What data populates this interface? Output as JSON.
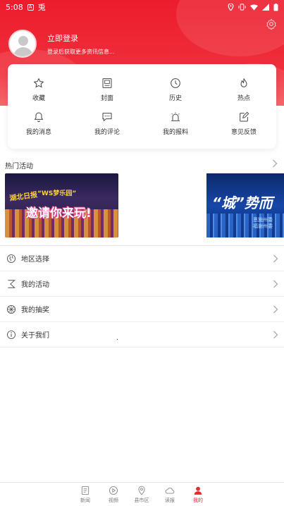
{
  "status_bar": {
    "time": "5:08",
    "box_glyph": "A",
    "extra_glyph": "兎"
  },
  "profile": {
    "login_title": "立即登录",
    "login_subtitle": "登录后获取更多资讯信息..."
  },
  "quick_actions": [
    {
      "label": "收藏",
      "icon": "star-icon"
    },
    {
      "label": "封面",
      "icon": "cover-icon"
    },
    {
      "label": "历史",
      "icon": "clock-icon"
    },
    {
      "label": "热点",
      "icon": "flame-icon"
    },
    {
      "label": "我的消息",
      "icon": "bell-icon"
    },
    {
      "label": "我的评论",
      "icon": "comment-icon"
    },
    {
      "label": "我的报料",
      "icon": "siren-icon"
    },
    {
      "label": "意见反馈",
      "icon": "edit-icon"
    }
  ],
  "hot_events": {
    "title": "热门活动",
    "banner1": {
      "line1": "湖北日报",
      "line2": "“WS梦乐园”",
      "line3": "邀请你来玩!"
    },
    "banner2": {
      "line1": "“城”势而",
      "line2": "恩施州委",
      "line3": "福谢州委"
    }
  },
  "menu": [
    {
      "label": "地区选择",
      "icon": "region-icon"
    },
    {
      "label": "我的活动",
      "icon": "activity-icon"
    },
    {
      "label": "我的抽奖",
      "icon": "lottery-icon"
    },
    {
      "label": "关于我们",
      "icon": "info-icon"
    }
  ],
  "bottom_nav": [
    {
      "label": "新闻",
      "icon": "news-icon",
      "active": false
    },
    {
      "label": "视频",
      "icon": "video-icon",
      "active": false
    },
    {
      "label": "县市区",
      "icon": "location-icon",
      "active": false
    },
    {
      "label": "读报",
      "icon": "cloud-icon",
      "active": false
    },
    {
      "label": "我的",
      "icon": "user-icon",
      "active": true
    }
  ],
  "colors": {
    "accent": "#e52a30",
    "header": "#ec1c2d"
  }
}
